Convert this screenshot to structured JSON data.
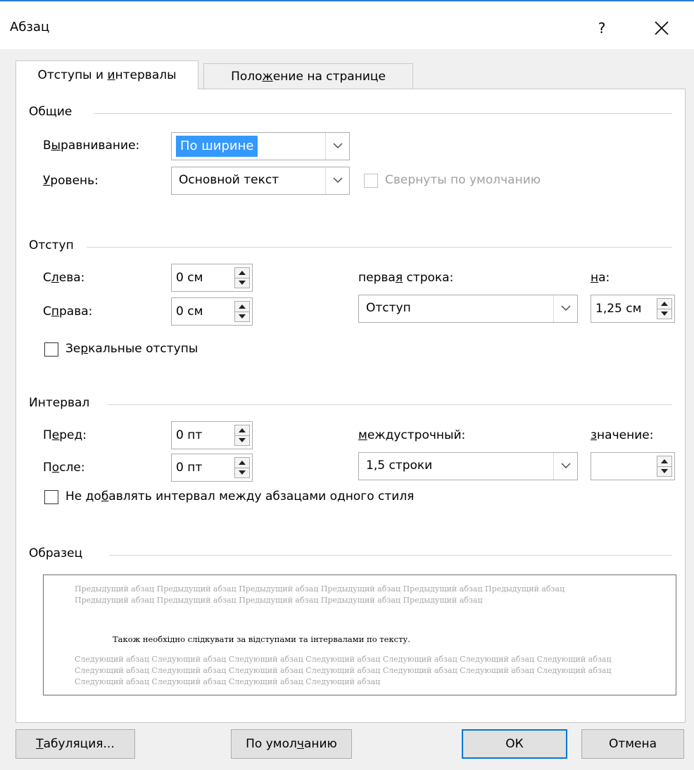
{
  "window": {
    "title": "Абзац",
    "help": "?"
  },
  "tabs": [
    {
      "pre": "Отступы и ",
      "mn": "и",
      "post": "нтервалы"
    },
    {
      "pre": "Поло",
      "mn": "ж",
      "post": "ение на странице"
    }
  ],
  "general": {
    "section": "Общие",
    "alignment": {
      "pre": "В",
      "mn": "ы",
      "post": "равнивание:",
      "value": "По ширине"
    },
    "level": {
      "pre": "",
      "mn": "У",
      "post": "ровень:",
      "value": "Основной текст"
    },
    "collapsed_label": "Свернуты по умолчанию"
  },
  "indent": {
    "section": "Отступ",
    "left": {
      "pre": "С",
      "mn": "л",
      "post": "ева:",
      "value": "0 см"
    },
    "right": {
      "pre": "С",
      "mn": "п",
      "post": "рава:",
      "value": "0 см"
    },
    "first_line": {
      "pre": "перва",
      "mn": "я",
      "post": " строка:",
      "value": "Отступ"
    },
    "by": {
      "pre": "",
      "mn": "н",
      "post": "а:",
      "value": "1,25 см"
    },
    "mirror": {
      "pre": "Зе",
      "mn": "р",
      "post": "кальные отступы"
    }
  },
  "spacing": {
    "section": "Интервал",
    "before": {
      "pre": "П",
      "mn": "е",
      "post": "ред:",
      "value": "0 пт"
    },
    "after": {
      "pre": "П",
      "mn": "о",
      "post": "сле:",
      "value": "0 пт"
    },
    "line": {
      "pre": "",
      "mn": "м",
      "post": "еждустрочный:",
      "value": "1,5 строки"
    },
    "at": {
      "pre": "",
      "mn": "з",
      "post": "начение:",
      "value": ""
    },
    "dont_add": {
      "pre": "Не до",
      "mn": "б",
      "post": "авлять интервал между абзацами одного стиля"
    }
  },
  "preview": {
    "section": "Образец",
    "previous": "Предыдущий абзац Предыдущий абзац Предыдущий абзац Предыдущий абзац Предыдущий абзац Предыдущий абзац Предыдущий абзац Предыдущий абзац Предыдущий абзац Предыдущий абзац Предыдущий абзац",
    "current": "Також необхідно слідкувати за відступами та інтервалами по тексту.",
    "next": "Следующий абзац Следующий абзац Следующий абзац Следующий абзац Следующий абзац Следующий абзац Следующий абзац Следующий абзац Следующий абзац Следующий абзац Следующий абзац Следующий абзац Следующий абзац Следующий абзац Следующий абзац Следующий абзац Следующий абзац Следующий абзац"
  },
  "buttons": {
    "tabs": {
      "pre": "",
      "mn": "Т",
      "post": "абуляция..."
    },
    "default": {
      "pre": "По умол",
      "mn": "ч",
      "post": "анию"
    },
    "ok": "ОК",
    "cancel": "Отмена"
  }
}
